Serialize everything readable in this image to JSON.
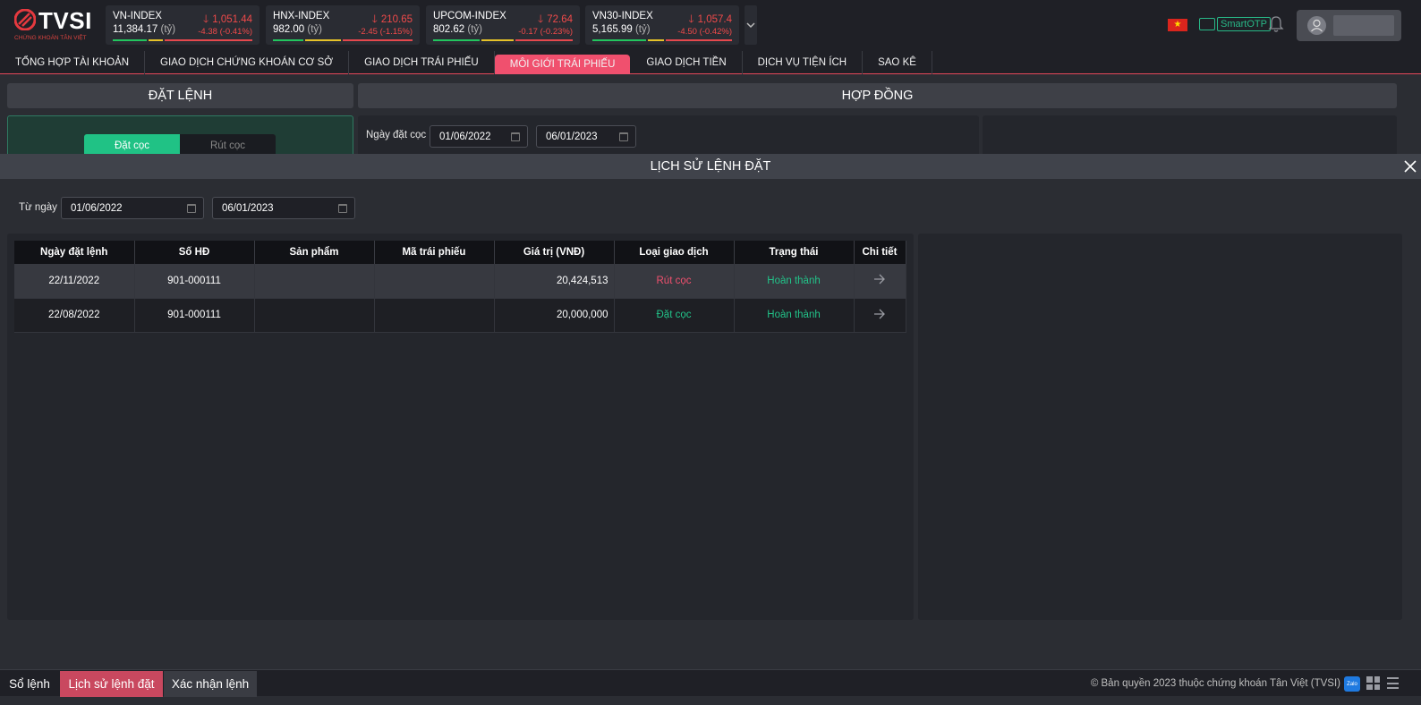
{
  "brand": {
    "name": "TVSI",
    "tagline": "CHỨNG KHOÁN TÂN VIỆT"
  },
  "indices": [
    {
      "name": "VN-INDEX",
      "point": "1,051.44",
      "volume": "11,384.17",
      "unit": "(tỷ)",
      "change": "-4.38",
      "pct": "(-0.41%)"
    },
    {
      "name": "HNX-INDEX",
      "point": "210.65",
      "volume": "982.00",
      "unit": "(tỷ)",
      "change": "-2.45",
      "pct": "(-1.15%)"
    },
    {
      "name": "UPCOM-INDEX",
      "point": "72.64",
      "volume": "802.62",
      "unit": "(tỷ)",
      "change": "-0.17",
      "pct": "(-0.23%)"
    },
    {
      "name": "VN30-INDEX",
      "point": "1,057.4",
      "volume": "5,165.99",
      "unit": "(tỷ)",
      "change": "-4.50",
      "pct": "(-0.42%)"
    }
  ],
  "header": {
    "smartotp": "SmartOTP"
  },
  "nav": [
    "TỔNG HỢP TÀI KHOẢN",
    "GIAO DỊCH CHỨNG KHOÁN CƠ SỞ",
    "GIAO DỊCH TRÁI PHIẾU",
    "MÔI GIỚI TRÁI PHIẾU",
    "GIAO DỊCH TIỀN",
    "DỊCH VỤ TIỆN ÍCH",
    "SAO KÊ"
  ],
  "sections": {
    "order": "ĐẶT LỆNH",
    "contract": "HỢP ĐỒNG"
  },
  "deposit_tabs": {
    "deposit": "Đặt cọc",
    "withdraw": "Rút cọc"
  },
  "contract_filter": {
    "label": "Ngày đặt cọc",
    "from": "01/06/2022",
    "to": "06/01/2023"
  },
  "modal": {
    "title": "LỊCH SỬ LỆNH ĐẶT",
    "from_label": "Từ ngày",
    "from": "01/06/2022",
    "to": "06/01/2023",
    "columns": [
      "Ngày đặt lệnh",
      "Số HĐ",
      "Sản phẩm",
      "Mã trái phiếu",
      "Giá trị (VNĐ)",
      "Loại giao dịch",
      "Trạng thái",
      "Chi tiết"
    ],
    "rows": [
      {
        "date": "22/11/2022",
        "contract": "901-000111",
        "product": "",
        "bond": "",
        "value": "20,424,513",
        "type": "Rút cọc",
        "status": "Hoàn thành"
      },
      {
        "date": "22/08/2022",
        "contract": "901-000111",
        "product": "",
        "bond": "",
        "value": "20,000,000",
        "type": "Đặt cọc",
        "status": "Hoàn thành"
      }
    ]
  },
  "footer": {
    "tabs": [
      "Sổ lệnh",
      "Lịch sử lệnh đặt",
      "Xác nhận lệnh"
    ],
    "copyright": "© Bản quyền 2023 thuộc chứng khoán Tân Việt (TVSI)",
    "zalo": "Zalo"
  },
  "colors": {
    "accent": "#f0506e",
    "up": "#22c389",
    "down": "#f04a4a",
    "deposit_tab": "#20c285"
  }
}
